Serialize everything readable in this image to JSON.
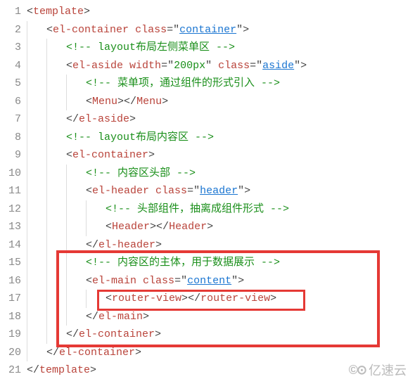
{
  "lineNumbers": [
    "1",
    "2",
    "3",
    "4",
    "5",
    "6",
    "7",
    "8",
    "9",
    "10",
    "11",
    "12",
    "13",
    "14",
    "15",
    "16",
    "17",
    "18",
    "19",
    "20",
    "21"
  ],
  "code": {
    "l1": {
      "open": "<",
      "tag": "template",
      "close": ">"
    },
    "l2": {
      "open": "<",
      "tag": "el-container",
      "sp": " ",
      "attr": "class",
      "eq": "=\"",
      "val": "container",
      "cq": "\"",
      "close": ">"
    },
    "l3": {
      "text": "<!-- layout布局左侧菜单区 -->"
    },
    "l4": {
      "open": "<",
      "tag": "el-aside",
      "sp": " ",
      "attr": "width",
      "eq": "=\"",
      "val": "200px",
      "cq": "\" ",
      "attr2": "class",
      "eq2": "=\"",
      "val2": "aside",
      "cq2": "\"",
      "close": ">"
    },
    "l5": {
      "text": "<!-- 菜单项，通过组件的形式引入 -->"
    },
    "l6": {
      "o1": "<",
      "t1": "Menu",
      "c1": ">",
      "o2": "</",
      "t2": "Menu",
      "c2": ">"
    },
    "l7": {
      "open": "</",
      "tag": "el-aside",
      "close": ">"
    },
    "l8": {
      "text": "<!-- layout布局内容区 -->"
    },
    "l9": {
      "open": "<",
      "tag": "el-container",
      "close": ">"
    },
    "l10": {
      "text": "<!-- 内容区头部 -->"
    },
    "l11": {
      "open": "<",
      "tag": "el-header",
      "sp": " ",
      "attr": "class",
      "eq": "=\"",
      "val": "header",
      "cq": "\"",
      "close": ">"
    },
    "l12": {
      "text": "<!-- 头部组件，抽离成组件形式 -->"
    },
    "l13": {
      "o1": "<",
      "t1": "Header",
      "c1": ">",
      "o2": "</",
      "t2": "Header",
      "c2": ">"
    },
    "l14": {
      "open": "</",
      "tag": "el-header",
      "close": ">"
    },
    "l15": {
      "text": "<!-- 内容区的主体，用于数据展示 -->"
    },
    "l16": {
      "open": "<",
      "tag": "el-main",
      "sp": " ",
      "attr": "class",
      "eq": "=\"",
      "val": "content",
      "cq": "\"",
      "close": ">"
    },
    "l17": {
      "o1": "<",
      "t1": "router-view",
      "c1": ">",
      "o2": "</",
      "t2": "router-view",
      "c2": ">"
    },
    "l18": {
      "open": "</",
      "tag": "el-main",
      "close": ">"
    },
    "l19": {
      "open": "</",
      "tag": "el-container",
      "close": ">"
    },
    "l20": {
      "open": "</",
      "tag": "el-container",
      "close": ">"
    },
    "l21": {
      "open": "</",
      "tag": "template",
      "close": ">"
    }
  },
  "watermark": "亿速云"
}
